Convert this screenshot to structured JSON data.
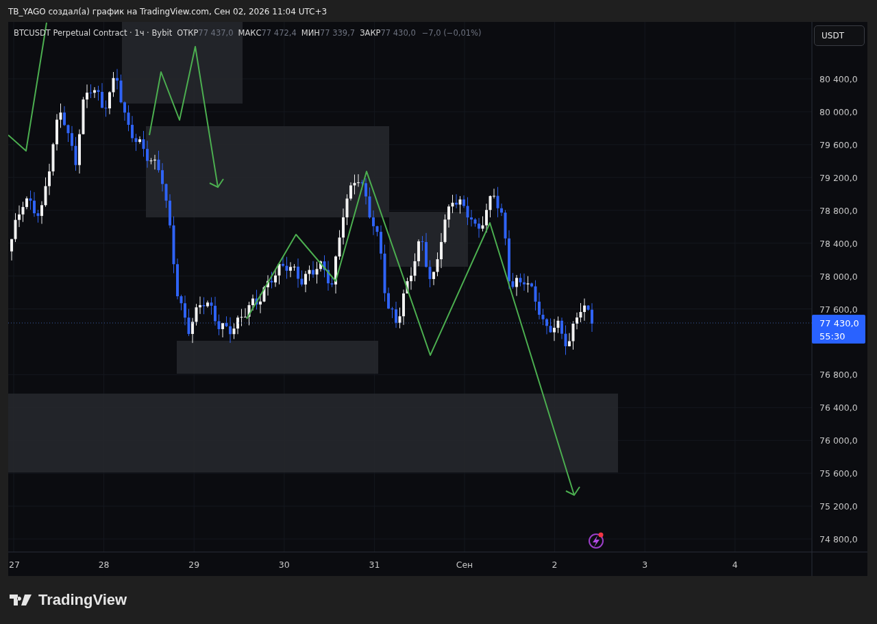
{
  "caption": "TB_YAGO создал(а) график на TradingView.com, Сен 02, 2026 11:04 UTC+3",
  "legend": {
    "symbol": "BTCUSDT Perpetual Contract · 1ч · Bybit",
    "fields": [
      {
        "label": "ОТКР",
        "value": "77 437,0"
      },
      {
        "label": "МАКС",
        "value": "77 472,4"
      },
      {
        "label": "МИН",
        "value": "77 339,7"
      },
      {
        "label": "ЗАКР",
        "value": "77 430,0"
      }
    ],
    "change": "−7,0 (−0,01%)"
  },
  "currency_button": "USDT",
  "price_axis": {
    "ticks": [
      "80 400,0",
      "80 000,0",
      "79 600,0",
      "79 200,0",
      "78 800,0",
      "78 400,0",
      "78 000,0",
      "77 600,0",
      "76 800,0",
      "76 400,0",
      "76 000,0",
      "75 600,0",
      "75 200,0",
      "74 800,0"
    ]
  },
  "price_tag": {
    "price": "77 430,0",
    "countdown": "55:30"
  },
  "time_axis": {
    "ticks": [
      "27",
      "28",
      "29",
      "30",
      "31",
      "Сен",
      "2",
      "3",
      "4"
    ]
  },
  "footer": {
    "logo": "TradingView"
  }
}
